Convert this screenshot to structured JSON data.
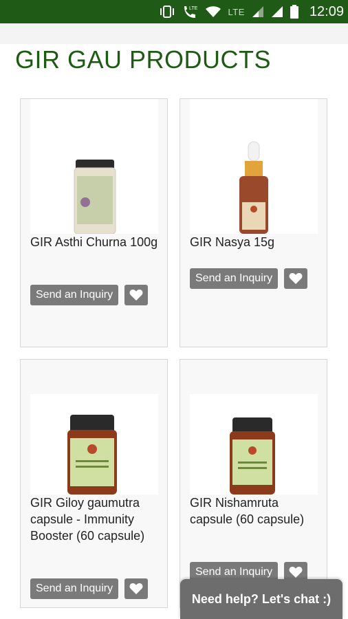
{
  "status_bar": {
    "network": "LTE",
    "time": "12:09",
    "icons": [
      "vibrate-icon",
      "volte-call-icon",
      "wifi-icon",
      "signal-icon",
      "signal-icon",
      "battery-icon"
    ]
  },
  "page": {
    "title": "GIR GAU PRODUCTS"
  },
  "products": [
    {
      "name": "GIR Asthi Churna 100g",
      "inquiry_label": "Send an Inquiry",
      "image_icon": "jar-icon"
    },
    {
      "name": "GIR Nasya 15g",
      "inquiry_label": "Send an Inquiry",
      "image_icon": "dropper-bottle-icon"
    },
    {
      "name": "GIR Giloy gaumutra capsule - Immunity Booster (60 capsule)",
      "inquiry_label": "Send an Inquiry",
      "image_icon": "capsule-bottle-icon"
    },
    {
      "name": "GIR Nishamruta capsule (60 capsule)",
      "inquiry_label": "Send an Inquiry",
      "image_icon": "capsule-bottle-icon"
    }
  ],
  "chat": {
    "label": "Need help? Let's chat :)"
  },
  "colors": {
    "status_bar": "#1f5b16",
    "title": "#1e5a14",
    "button": "#7a7a7a",
    "chat": "#6d6d6d"
  }
}
